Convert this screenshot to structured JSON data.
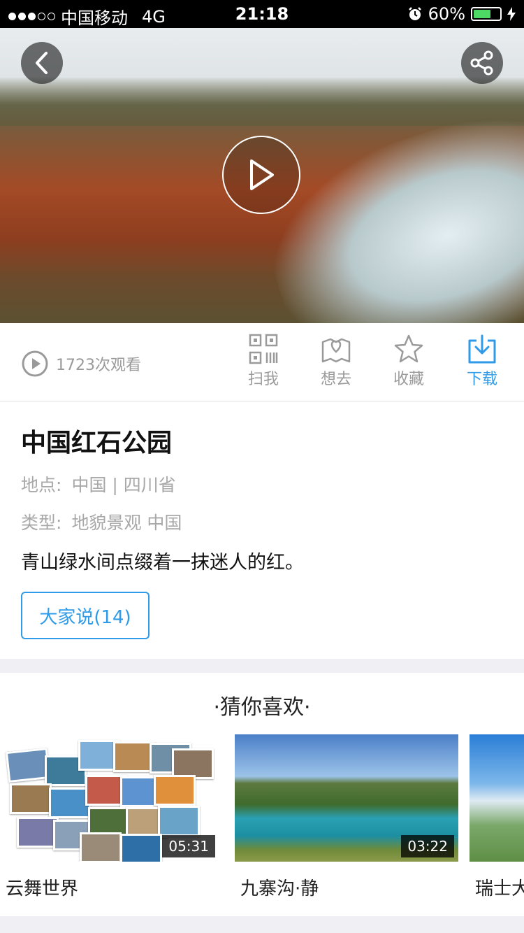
{
  "status_bar": {
    "carrier": "中国移动",
    "network": "4G",
    "time": "21:18",
    "battery": "60%",
    "battery_level": 0.6,
    "signal_bars_filled": 3,
    "signal_bars_total": 5
  },
  "hero": {
    "back_icon": "chevron-left-icon",
    "share_icon": "share-icon",
    "play_icon": "play-icon"
  },
  "action_bar": {
    "view_count": "1723次观看",
    "actions": [
      {
        "label": "扫我",
        "icon": "qr-code-icon"
      },
      {
        "label": "想去",
        "icon": "map-heart-icon"
      },
      {
        "label": "收藏",
        "icon": "star-icon"
      },
      {
        "label": "下载",
        "icon": "download-icon"
      }
    ],
    "accent": "#2f9be8"
  },
  "info": {
    "title": "中国红石公园",
    "location_label": "地点:",
    "location_value": "中国 | 四川省",
    "type_label": "类型:",
    "type_value": "地貌景观 中国",
    "description": "青山绿水间点缀着一抹迷人的红。",
    "comments_button": "大家说(14)"
  },
  "recommend": {
    "title": "·猜你喜欢·",
    "items": [
      {
        "title": "云舞世界",
        "duration": "05:31"
      },
      {
        "title": "九寨沟·静",
        "duration": "03:22"
      },
      {
        "title": "瑞士大",
        "duration": ""
      }
    ]
  }
}
